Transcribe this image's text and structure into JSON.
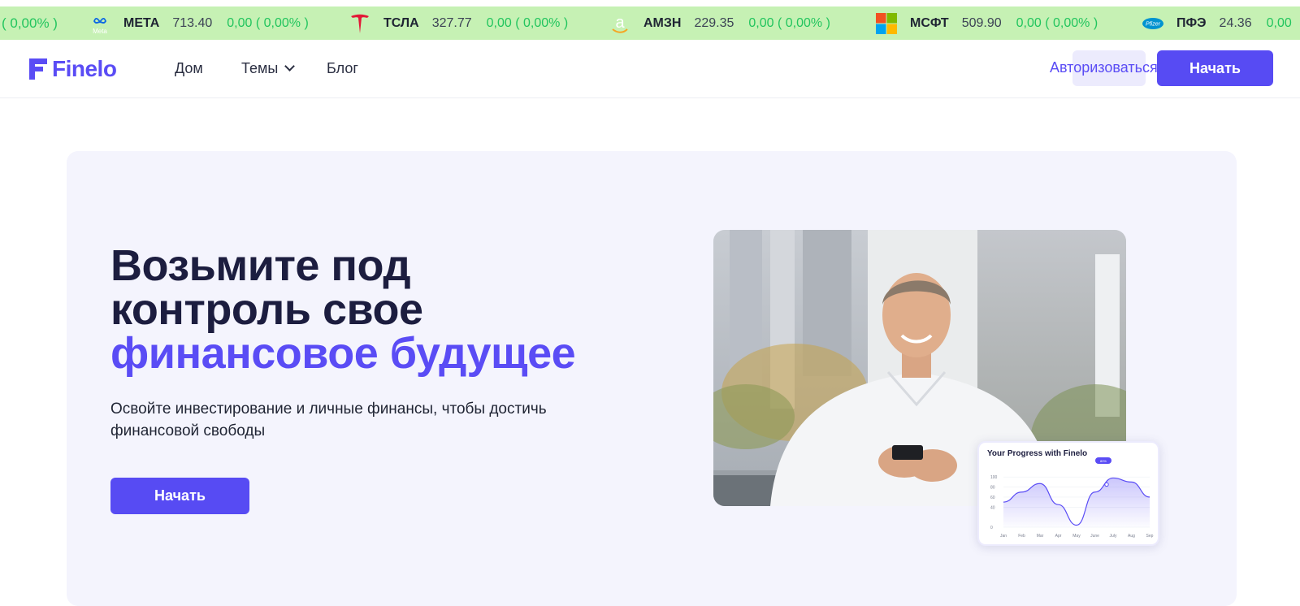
{
  "ticker": {
    "lead_change": "( 0,00% )",
    "items": [
      {
        "symbol": "МЕТА",
        "price": "713.40",
        "change": "0,00 ( 0,00% )",
        "logo": "meta-logo",
        "logo_text": "Meta"
      },
      {
        "symbol": "ТСЛА",
        "price": "327.77",
        "change": "0,00 ( 0,00% )",
        "logo": "tesla-logo"
      },
      {
        "symbol": "АМЗН",
        "price": "229.35",
        "change": "0,00 ( 0,00% )",
        "logo": "amazon-logo"
      },
      {
        "symbol": "МСФТ",
        "price": "509.90",
        "change": "0,00 ( 0,00% )",
        "logo": "microsoft-logo"
      },
      {
        "symbol": "ПФЭ",
        "price": "24.36",
        "change": "0,00",
        "logo": "pfizer-logo",
        "logo_text": "Pfizer"
      }
    ],
    "colors": {
      "background": "#c6f1b4",
      "positive": "#22c55e"
    }
  },
  "header": {
    "brand": "Finelo",
    "nav": {
      "home": "Дом",
      "topics": "Темы",
      "blog": "Блог"
    },
    "login": "Авторизоваться",
    "cta": "Начать",
    "accent": "#574bf3"
  },
  "hero": {
    "title_line1": "Возьмите под",
    "title_line2": "контроль свое",
    "title_line3": "финансовое будущее",
    "subtitle": "Освойте инвестирование и личные финансы, чтобы достичь финансовой свободы",
    "cta": "Начать",
    "image": "smiling-man-with-phone-photo"
  },
  "progress_card": {
    "title": "Your Progress with Finelo",
    "chart_data": {
      "type": "area",
      "categories": [
        "Jan",
        "Feb",
        "Mar",
        "Apr",
        "May",
        "June",
        "July",
        "Aug",
        "Sep"
      ],
      "values": [
        50,
        70,
        87,
        45,
        4,
        70,
        98,
        90,
        60
      ],
      "ylim": [
        0,
        110
      ],
      "yticks": [
        "100",
        "80",
        "60",
        "40",
        "0"
      ],
      "highlight_label": "80%",
      "grid": true
    }
  }
}
